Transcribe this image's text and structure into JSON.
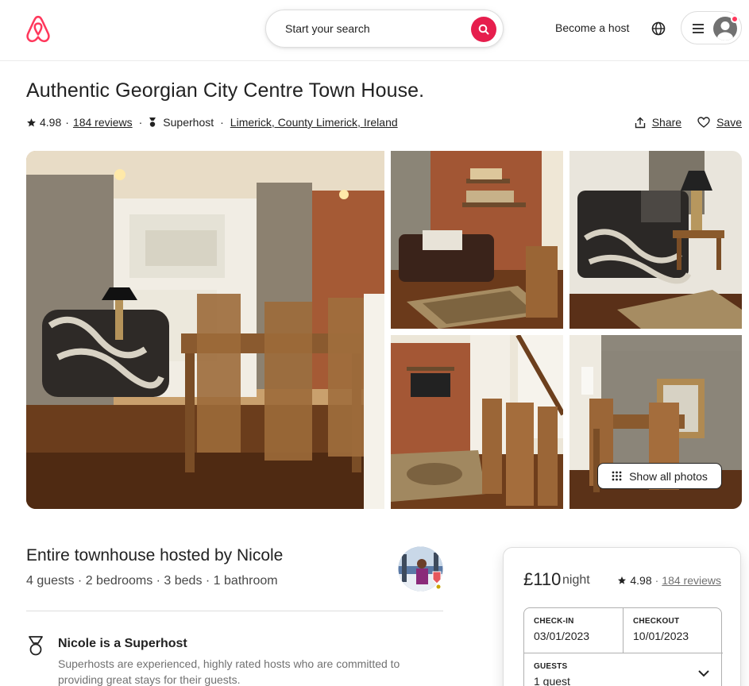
{
  "header": {
    "search_placeholder": "Start your search",
    "become_host": "Become a host"
  },
  "listing": {
    "title": "Authentic Georgian City Centre Town House.",
    "rating": "4.98",
    "reviews": "184 reviews",
    "host_badge": "Superhost",
    "location": "Limerick, County Limerick, Ireland",
    "share": "Share",
    "save": "Save",
    "show_all_photos": "Show all photos",
    "hosted_by": "Entire townhouse hosted by Nicole",
    "specs": "4 guests · 2 bedrooms · 3 beds · 1 bathroom",
    "superhost_title": "Nicole is a Superhost",
    "superhost_desc": "Superhosts are experienced, highly rated hosts who are committed to providing great stays for their guests."
  },
  "booking": {
    "price": "£110",
    "per": "night",
    "rating": "4.98",
    "reviews": "184 reviews",
    "checkin_label": "CHECK-IN",
    "checkin_value": "03/01/2023",
    "checkout_label": "CHECKOUT",
    "checkout_value": "10/01/2023",
    "guests_label": "GUESTS",
    "guests_value": "1 guest"
  },
  "colors": {
    "brand": "#ff385c",
    "search_button": "#e61e4d",
    "text": "#222222",
    "muted": "#717171",
    "border": "#dddddd"
  },
  "icons": [
    "airbnb-logo",
    "search-icon",
    "globe-icon",
    "hamburger-menu-icon",
    "user-avatar-icon",
    "star-icon",
    "superhost-medal-icon",
    "share-icon",
    "heart-icon",
    "grid-dots-icon",
    "chevron-down-icon"
  ]
}
